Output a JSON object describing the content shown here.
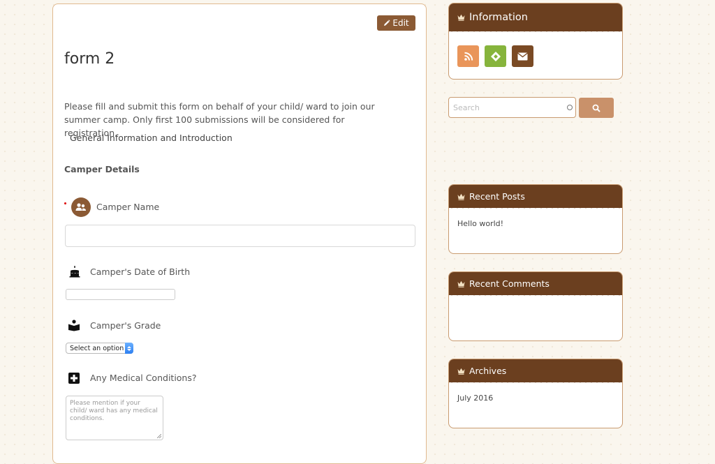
{
  "post": {
    "edit_label": "Edit",
    "title": "form 2",
    "intro": "Please fill and submit this form on behalf of your child/ ward to join our summer camp. Only first 100 submissions will be considered for registration.",
    "section_intro": "General Information and Introduction",
    "section_heading": "Camper Details"
  },
  "form": {
    "fields": [
      {
        "label": "Camper Name",
        "icon": "people-icon",
        "required": true
      },
      {
        "label": "Camper's Date of Birth",
        "icon": "birthday-cake-icon"
      },
      {
        "label": "Camper's Grade",
        "icon": "reader-icon",
        "selected_option": "Select an option"
      },
      {
        "label": "Any Medical Conditions?",
        "icon": "medical-cross-icon",
        "placeholder": "Please mention if your child/ ward has any medical conditions."
      }
    ]
  },
  "sidebar": {
    "information": {
      "title": "Information",
      "icons": [
        "rss-icon",
        "feedly-icon",
        "email-icon"
      ]
    },
    "search": {
      "placeholder": "Search",
      "button_icon": "search-icon"
    },
    "recent_posts": {
      "title": "Recent Posts",
      "items": [
        "Hello world!"
      ]
    },
    "recent_comments": {
      "title": "Recent Comments",
      "items": []
    },
    "archives": {
      "title": "Archives",
      "items": [
        "July 2016"
      ]
    }
  },
  "colors": {
    "brown_dark": "#6b3f1f",
    "brown": "#8b5a34",
    "tan_button": "#c9916a",
    "rss": "#e9955a",
    "feedly": "#86b43c",
    "background": "#faf6ee"
  }
}
